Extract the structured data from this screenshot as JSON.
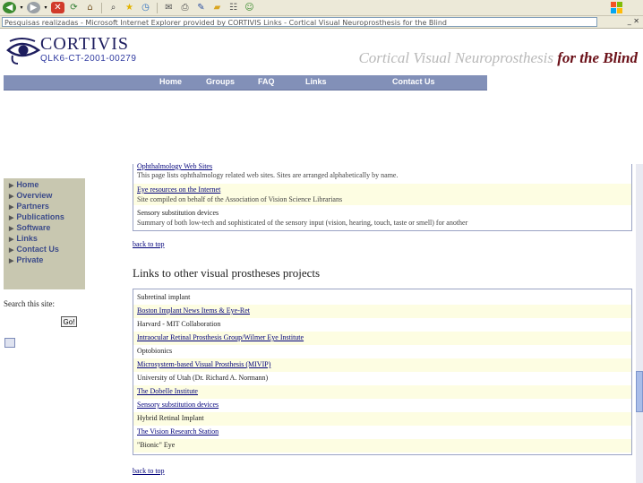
{
  "header": {
    "logo_name": "CORTIVIS",
    "logo_code": "QLK6-CT-2001-00279",
    "tagline_part1": "Cortical Visual Neuroprosthesis",
    "tagline_part2": "for the Blind"
  },
  "topnav": [
    "Home",
    "Groups",
    "FAQ",
    "Links",
    "Contact Us"
  ],
  "sidebar": {
    "items": [
      "Home",
      "Overview",
      "Partners",
      "Publications",
      "Software",
      "Links",
      "Contact Us",
      "Private"
    ],
    "search_label": "Search this site:",
    "go_label": "Go!"
  },
  "content": {
    "section1_rows": [
      {
        "title": "Ophthalmology Web Sites",
        "desc": "This page lists ophthalmology related web sites. Sites are arranged alphabetically by name."
      },
      {
        "title": "Eye resources on the Internet",
        "desc": "Site compiled on behalf of the Association of Vision Science Librarians"
      },
      {
        "title": "Sensory substitution devices",
        "desc": "Summary of both low-tech and sophisticated of the sensory input (vision, hearing, touch, taste or smell) for another"
      }
    ],
    "back_label_1": "back to top",
    "section2_title": "Links to other visual prostheses projects",
    "section2_rows": [
      "Subretinal implant",
      "Boston Implant News Items & Eye-Ret",
      "Harvard - MIT Collaboration",
      "Intraocular Retinal Prosthesis Group/Wilmer Eye Institute",
      "Optobionics",
      "Microsystem-based Visual Prosthesis (MIVIP)",
      "University of Utah (Dr. Richard A. Normann)",
      "The Dobelle Institute",
      "Sensory substitution devices",
      "Hybrid Retinal Implant",
      "The Vision Research Station",
      "\"Bionic\" Eye"
    ],
    "back_label_2": "back to top"
  },
  "browser": {
    "address": "Pesquisas realizadas - Microsoft Internet Explorer provided by CORTIVIS Links - Cortical Visual Neuroprosthesis for the Blind"
  },
  "icons": [
    "back-icon",
    "forward-icon",
    "stop-icon",
    "refresh-icon",
    "home-icon",
    "search-icon",
    "favorites-icon",
    "history-icon",
    "mail-icon",
    "print-icon",
    "edit-icon",
    "folder-icon",
    "discuss-icon",
    "messenger-icon",
    "windows-logo-icon"
  ],
  "colors": {
    "nav": "#8290b8",
    "sidebar": "#c8c7b0",
    "row_highlight": "#fdfde2",
    "accent": "#6a0f17"
  }
}
